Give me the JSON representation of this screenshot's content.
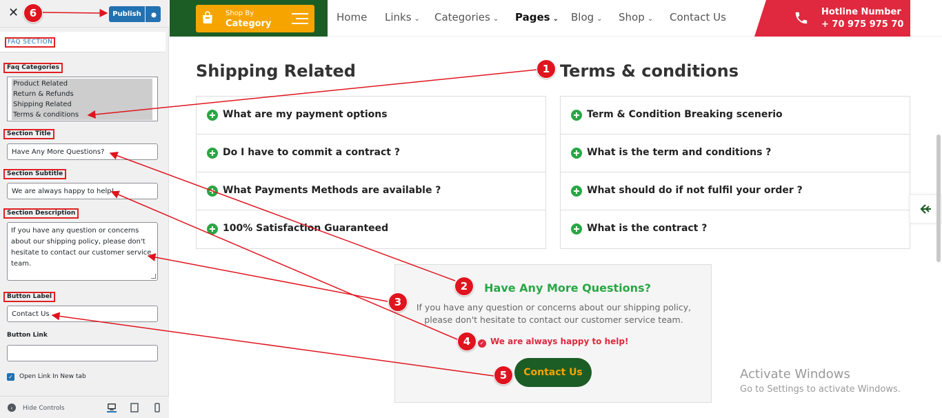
{
  "panel": {
    "publish_label": "Publish",
    "section_title": "FAQ SECTION",
    "faq_categories_label": "Faq Categories",
    "categories": [
      "Product Related",
      "Return & Refunds",
      "Shipping Related",
      "Terms & conditions"
    ],
    "section_title_label": "Section Title",
    "section_title_value": "Have Any More Questions?",
    "section_subtitle_label": "Section Subtitle",
    "section_subtitle_value": "We are always happy to help!",
    "section_description_label": "Section Description",
    "section_description_value": "If you have any question or concerns about our shipping policy, please don't hesitate to contact our customer service team.",
    "button_label_label": "Button Label",
    "button_label_value": "Contact Us",
    "button_link_label": "Button Link",
    "button_link_value": "",
    "open_link_label": "Open Link In New tab",
    "hide_controls_label": "Hide Controls"
  },
  "site": {
    "shop_by": "Shop By",
    "category": "Category",
    "menu": [
      "Home",
      "Links",
      "Categories",
      "Pages",
      "Blog",
      "Shop",
      "Contact Us"
    ],
    "hotline_label": "Hotline Number",
    "hotline_number": "+ 70 975 975 70",
    "faq": {
      "left_title": "Shipping Related",
      "right_title": "Terms & conditions",
      "left_questions": [
        "What are my payment options",
        "Do I have to commit a contract ?",
        "What Payments Methods are available ?",
        "100% Satisfaction Guaranteed"
      ],
      "right_questions": [
        "Term & Condition Breaking scenerio",
        "What is the term and conditions ?",
        "What should do if not fulfil your order ?",
        "What is the contract ?"
      ]
    },
    "cta": {
      "title": "Have Any More Questions?",
      "description": "If you have any question or concerns about our shipping policy, please don't hesitate to contact our customer service team.",
      "subtitle": "We are always happy to help!",
      "button": "Contact Us"
    },
    "activate_line1": "Activate Windows",
    "activate_line2": "Go to Settings to activate Windows."
  },
  "annotations": [
    "1",
    "2",
    "3",
    "4",
    "5",
    "6"
  ],
  "colors": {
    "brand_green": "#1c5d25",
    "accent_orange": "#f6a400",
    "hotline_red": "#e0283e",
    "faq_plus_green": "#28a745",
    "wp_blue": "#2271b1",
    "annotation_red": "#e0141e"
  }
}
